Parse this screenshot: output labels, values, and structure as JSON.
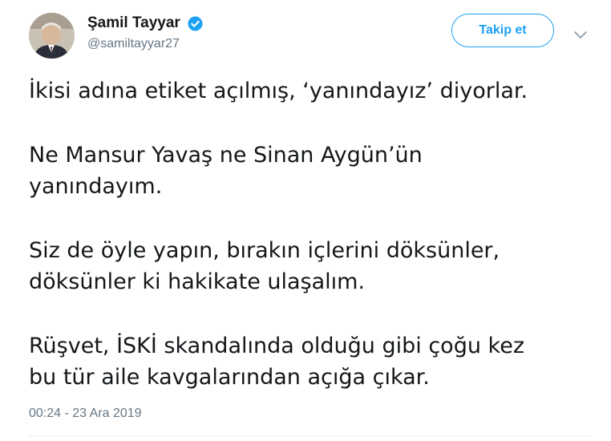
{
  "author": {
    "display_name": "Şamil Tayyar",
    "handle": "@samiltayyar27",
    "verified": true
  },
  "actions": {
    "follow_label": "Takip et",
    "menu_icon": "chevron-down-icon"
  },
  "tweet": {
    "paragraphs": [
      [
        "İkisi adına etiket açılmış, ‘yanındayız’ diyorlar."
      ],
      [
        "Ne Mansur Yavaş ne Sinan Aygün’ün",
        "yanındayım."
      ],
      [
        "Siz de öyle yapın, bırakın içlerini döksünler,",
        "döksünler ki hakikate ulaşalım."
      ],
      [
        "Rüşvet, İSKİ skandalında olduğu gibi çoğu kez",
        "bu tür aile kavgalarından açığa çıkar."
      ]
    ],
    "timestamp": "00:24 - 23 Ara 2019"
  },
  "colors": {
    "accent": "#1da1f2",
    "text": "#14171a",
    "muted": "#657786"
  }
}
